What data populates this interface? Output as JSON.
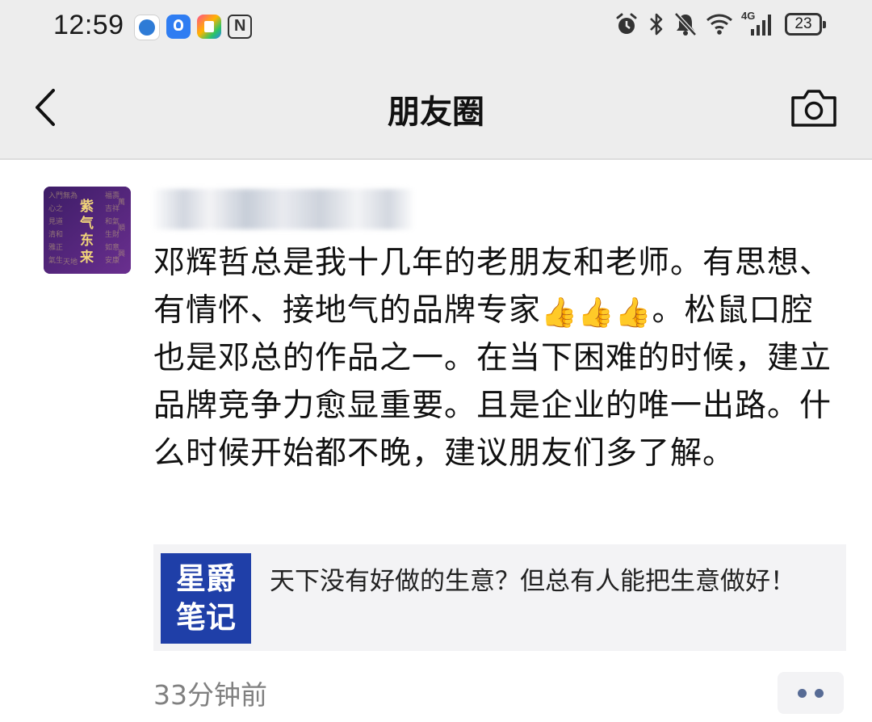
{
  "status_bar": {
    "time": "12:59",
    "app_icons": [
      "maps-app-icon",
      "bulb-app-icon",
      "colorful-app-icon",
      "nfc-icon"
    ],
    "system_icons": [
      "alarm-icon",
      "bluetooth-icon",
      "mute-icon",
      "wifi-icon",
      "cellular-signal-icon"
    ],
    "network_label": "4G",
    "battery": "23"
  },
  "header": {
    "back_icon": "chevron-left-icon",
    "title": "朋友圈",
    "camera_icon": "camera-icon"
  },
  "post": {
    "avatar_text": [
      "紫",
      "气",
      "东",
      "来"
    ],
    "username": "",
    "text_parts": [
      "邓辉哲总是我十几年的老朋友和老师。有思想、有情怀、接地气的品牌专家",
      "👍",
      "👍",
      "👍",
      "。松鼠口腔也是邓总的作品之一。在当下困难的时候，建立品牌竞争力愈显重要。且是企业的唯一出路。什么时候开始都不晚，建议朋友们多了解。"
    ],
    "link": {
      "logo_line1": "星爵",
      "logo_line2": "笔记",
      "title": "天下没有好做的生意？但总有人能把生意做好！"
    },
    "time_ago": "33分钟前",
    "more_icon": "more-dots-icon"
  },
  "colors": {
    "header_bg": "#ededed",
    "link_card_bg": "#f3f3f5",
    "link_logo_bg": "#1f3fa8",
    "time_text": "#808080",
    "dots_color": "#576b95"
  }
}
